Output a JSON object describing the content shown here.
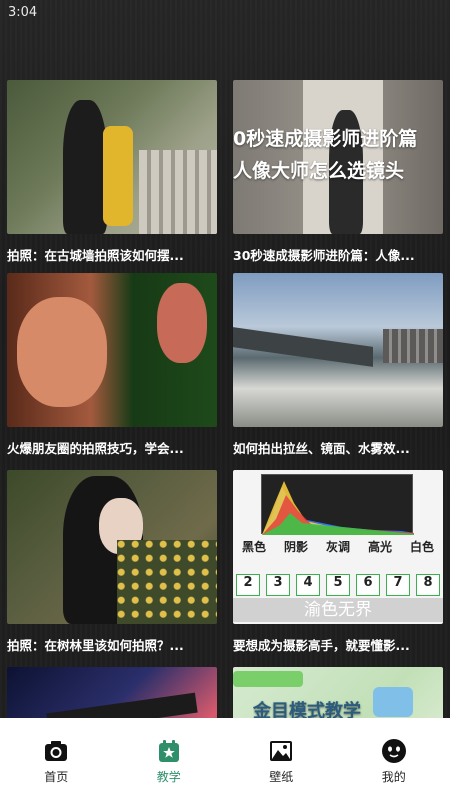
{
  "status_bar": {
    "time": "3:04"
  },
  "feed": {
    "cards": [
      {
        "caption": "拍照：在古城墙拍照该如何摆..."
      },
      {
        "caption": "30秒速成摄影师进阶篇：人像...",
        "overlay_line1": "0秒速成摄影师进阶篇",
        "overlay_line2": "人像大师怎么选镜头"
      },
      {
        "caption": "火爆朋友圈的拍照技巧，学会..."
      },
      {
        "caption": "如何拍出拉丝、镜面、水雾效..."
      },
      {
        "caption": "拍照：在树林里该如何拍照？..."
      },
      {
        "caption": "要想成为摄影高手，就要懂影...",
        "hist_labels": [
          "黑色",
          "阴影",
          "灰调",
          "高光",
          "白色"
        ],
        "hist_numbers": [
          "2",
          "3",
          "4",
          "5",
          "6",
          "7",
          "8"
        ],
        "watermark": "渝色无界"
      },
      {
        "caption": ""
      },
      {
        "caption": "",
        "overlay": "金目模式教学"
      }
    ]
  },
  "tabbar": {
    "tabs": [
      {
        "label": "首页",
        "icon": "camera-icon"
      },
      {
        "label": "教学",
        "icon": "teaching-icon"
      },
      {
        "label": "壁纸",
        "icon": "wallpaper-icon"
      },
      {
        "label": "我的",
        "icon": "profile-icon"
      }
    ],
    "active_color": "#2f8f6a"
  }
}
